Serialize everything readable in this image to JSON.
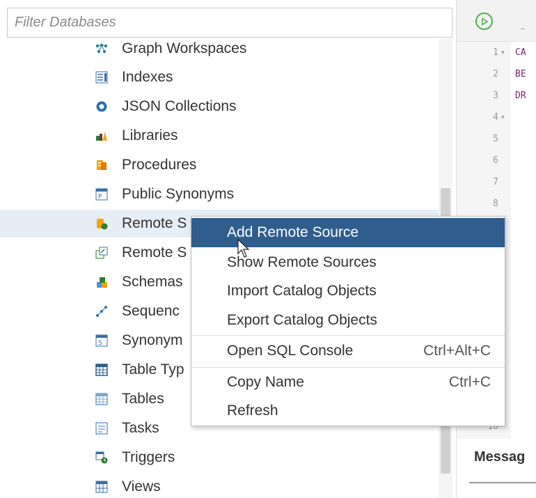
{
  "filter": {
    "placeholder": "Filter Databases"
  },
  "tree": {
    "items": [
      {
        "label": "Graph Workspaces",
        "icon": "graph-workspaces-icon"
      },
      {
        "label": "Indexes",
        "icon": "indexes-icon"
      },
      {
        "label": "JSON Collections",
        "icon": "json-collections-icon"
      },
      {
        "label": "Libraries",
        "icon": "libraries-icon"
      },
      {
        "label": "Procedures",
        "icon": "procedures-icon"
      },
      {
        "label": "Public Synonyms",
        "icon": "public-synonyms-icon"
      },
      {
        "label": "Remote S",
        "icon": "remote-sources-icon",
        "selected": true
      },
      {
        "label": "Remote S",
        "icon": "remote-subscriptions-icon"
      },
      {
        "label": "Schemas",
        "icon": "schemas-icon"
      },
      {
        "label": "Sequenc",
        "icon": "sequences-icon"
      },
      {
        "label": "Synonym",
        "icon": "synonyms-icon"
      },
      {
        "label": "Table Typ",
        "icon": "table-types-icon"
      },
      {
        "label": "Tables",
        "icon": "tables-icon"
      },
      {
        "label": "Tasks",
        "icon": "tasks-icon"
      },
      {
        "label": "Triggers",
        "icon": "triggers-icon"
      },
      {
        "label": "Views",
        "icon": "views-icon"
      }
    ]
  },
  "editor": {
    "lines": [
      {
        "no": "1",
        "fold": "▾",
        "code": "CA"
      },
      {
        "no": "2",
        "fold": "",
        "code": "BE"
      },
      {
        "no": "3",
        "fold": "",
        "code": "DR"
      },
      {
        "no": "4",
        "fold": "▾",
        "code": ""
      },
      {
        "no": "5",
        "fold": "",
        "code": ""
      },
      {
        "no": "6",
        "fold": "",
        "code": ""
      },
      {
        "no": "7",
        "fold": "",
        "code": ""
      },
      {
        "no": "8",
        "fold": "",
        "code": ""
      },
      {
        "no": "16",
        "fold": "",
        "code": ""
      }
    ],
    "messages_tab": "Messag"
  },
  "context_menu": {
    "items": [
      {
        "label": "Add Remote Source",
        "shortcut": "",
        "highlighted": true
      },
      {
        "label": "Show Remote Sources",
        "shortcut": ""
      },
      {
        "label": "Import Catalog Objects",
        "shortcut": ""
      },
      {
        "label": "Export Catalog Objects",
        "shortcut": ""
      },
      {
        "label": "Open SQL Console",
        "shortcut": "Ctrl+Alt+C"
      },
      {
        "label": "Copy Name",
        "shortcut": "Ctrl+C"
      },
      {
        "label": "Refresh",
        "shortcut": ""
      }
    ]
  },
  "colors": {
    "menu_highlight": "#2f5d8c",
    "selected_row": "#e6edf5",
    "run_button": "#4caf50",
    "code_keyword": "#7a1f6e"
  }
}
